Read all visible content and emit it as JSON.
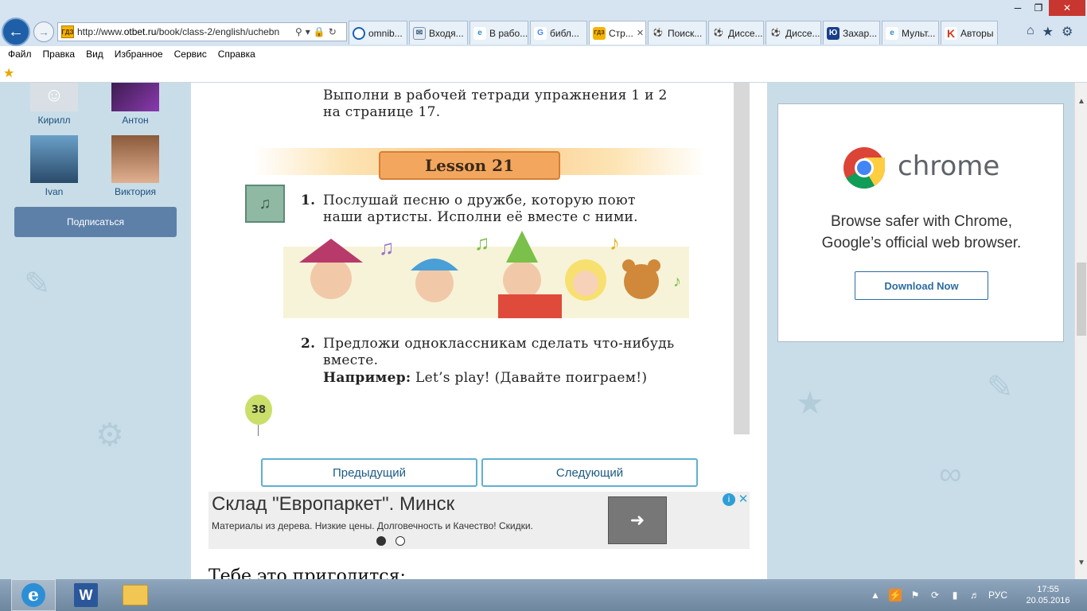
{
  "browser": {
    "url_prefix": "http://www.",
    "url_domain": "otbet.ru",
    "url_path": "/book/class-2/english/uchebn",
    "favicon_text": "ГДЗ",
    "tabs": [
      {
        "label": "omnib...",
        "icon": "circle-icon"
      },
      {
        "label": "Входя...",
        "icon": "mail-icon"
      },
      {
        "label": "В рабо...",
        "icon": "ie-icon"
      },
      {
        "label": "библ...",
        "icon": "google-icon"
      },
      {
        "label": "Стр...",
        "icon": "gdz-icon",
        "active": true
      },
      {
        "label": "Поиск...",
        "icon": "soccer-icon"
      },
      {
        "label": "Диссе...",
        "icon": "soccer-icon"
      },
      {
        "label": "Диссе...",
        "icon": "soccer-icon"
      },
      {
        "label": "Захар...",
        "icon": "lib-icon"
      },
      {
        "label": "Мульт...",
        "icon": "ie-icon"
      },
      {
        "label": "Авторы",
        "icon": "k-icon"
      }
    ],
    "menu": [
      "Файл",
      "Правка",
      "Вид",
      "Избранное",
      "Сервис",
      "Справка"
    ]
  },
  "sidebar": {
    "friends": [
      {
        "name": "Кирилл"
      },
      {
        "name": "Антон"
      },
      {
        "name": "Ivan"
      },
      {
        "name": "Виктория"
      }
    ],
    "subscribe_label": "Подписаться"
  },
  "book": {
    "intro_line1": "Выполни в рабочей тетради упражнения 1 и 2",
    "intro_line2": "на странице 17.",
    "lesson_title": "Lesson 21",
    "task1_num": "1.",
    "task1_line1": "Послушай песню о дружбе, которую поют",
    "task1_line2": "наши артисты. Исполни её вместе с ними.",
    "task2_num": "2.",
    "task2_line1": "Предложи одноклассникам сделать что-нибудь",
    "task2_line2": "вместе.",
    "example_label": "Например:",
    "example_text": "Let’s play! (Давайте поиграем!)",
    "page_number": "38"
  },
  "pager": {
    "prev_label": "Предыдущий",
    "next_label": "Следующий"
  },
  "ad": {
    "title": "Склад \"Европаркет\". Минск",
    "text": "Материалы из дерева. Низкие цены. Долговечность и Качество! Скидки."
  },
  "related_heading": "Тебе это пригодится:",
  "chrome_ad": {
    "brand": "chrome",
    "tagline1": "Browse safer with Chrome,",
    "tagline2": "Google’s official web browser.",
    "button_label": "Download Now"
  },
  "taskbar": {
    "lang": "РУС",
    "time": "17:55",
    "date": "20.05.2016"
  }
}
